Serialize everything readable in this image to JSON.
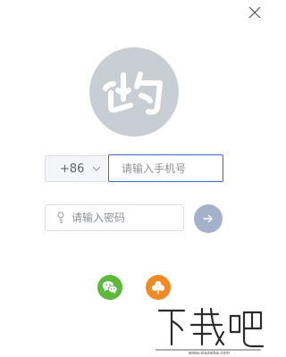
{
  "login": {
    "country_code": "+86",
    "phone_placeholder": "请输入手机号",
    "password_placeholder": "请输入密码"
  },
  "icons": {
    "close": "close-icon",
    "avatar": "app-logo-icon",
    "dropdown": "chevron-down-icon",
    "password": "key-icon",
    "submit": "arrow-right-icon",
    "social_1": "wechat-icon",
    "social_2": "clover-icon"
  },
  "colors": {
    "avatar_bg": "#c9cdd4",
    "input_focus_border": "#3d64c6",
    "submit_bg": "#a4b1cb",
    "wechat": "#5cb93a",
    "other_login": "#f08a25"
  },
  "watermark_text": "下载吧"
}
